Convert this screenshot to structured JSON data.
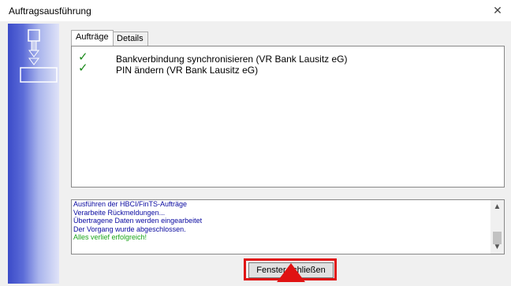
{
  "window": {
    "title": "Auftragsausführung",
    "close_glyph": "✕"
  },
  "tabs": [
    {
      "label": "Aufträge",
      "active": true
    },
    {
      "label": "Details",
      "active": false
    }
  ],
  "jobs": [
    {
      "check": "✓",
      "label": "Bankverbindung synchronisieren (VR Bank Lausitz eG)"
    },
    {
      "check": "✓",
      "label": "PIN ändern (VR Bank Lausitz eG)"
    }
  ],
  "log": {
    "lines": [
      {
        "text": "Ausführen der HBCI/FinTS-Aufträge",
        "status": "info"
      },
      {
        "text": "Verarbeite Rückmeldungen...",
        "status": "info"
      },
      {
        "text": "Übertragene Daten werden eingearbeitet",
        "status": "info"
      },
      {
        "text": "Der Vorgang wurde abgeschlossen.",
        "status": "info"
      },
      {
        "text": "Alles verlief erfolgreich!",
        "status": "success"
      }
    ],
    "scroll_up": "▲",
    "scroll_down": "▼"
  },
  "close_button": {
    "label": "Fenster schließen"
  },
  "colors": {
    "info_text": "#0a0aa0",
    "success_text": "#1aa51a",
    "check": "#1a8a1a",
    "highlight": "#e01212",
    "side_gradient_dark": "#3b4bc8"
  }
}
